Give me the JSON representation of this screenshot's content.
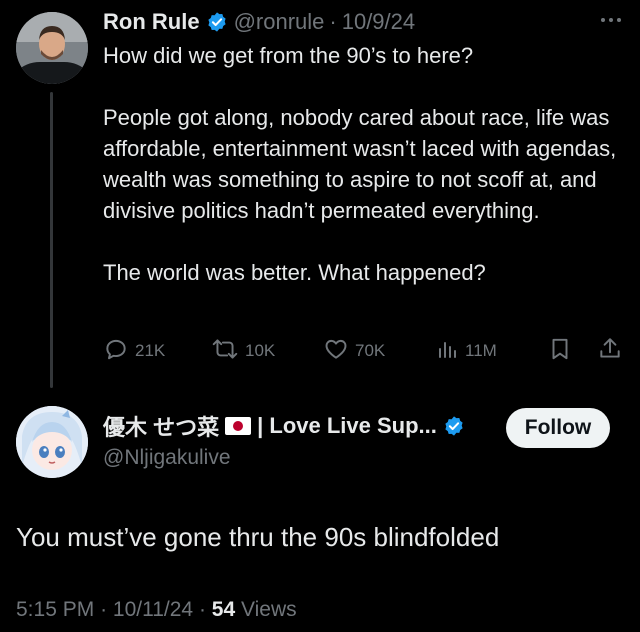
{
  "parent_tweet": {
    "author_name": "Ron Rule",
    "handle": "@ronrule",
    "separator": "·",
    "date": "10/9/24",
    "more_icon": "ellipsis-icon",
    "paragraphs": [
      "How did we get from the 90’s to here?",
      "People got along, nobody cared about race, life was affordable, entertainment wasn’t laced with agendas, wealth was something to aspire to not scoff at, and divisive politics hadn’t permeated everything.",
      "The world was better. What happened?"
    ],
    "actions": {
      "replies": "21K",
      "reposts": "10K",
      "likes": "70K",
      "views": "11M"
    }
  },
  "reply_tweet": {
    "author_name": "優木 せつ菜",
    "author_suffix": "| Love Live Sup...",
    "handle": "@Nljigakulive",
    "follow_label": "Follow",
    "text": "You must’ve gone thru the 90s blindfolded",
    "time": "5:15 PM",
    "separator": "·",
    "date": "10/11/24",
    "separator2": "·",
    "views_count": "54",
    "views_label": "Views"
  },
  "colors": {
    "background": "#000000",
    "text": "#e7e9ea",
    "secondary": "#71767b",
    "verified": "#1d9bf0",
    "follow_bg": "#eff3f4"
  }
}
